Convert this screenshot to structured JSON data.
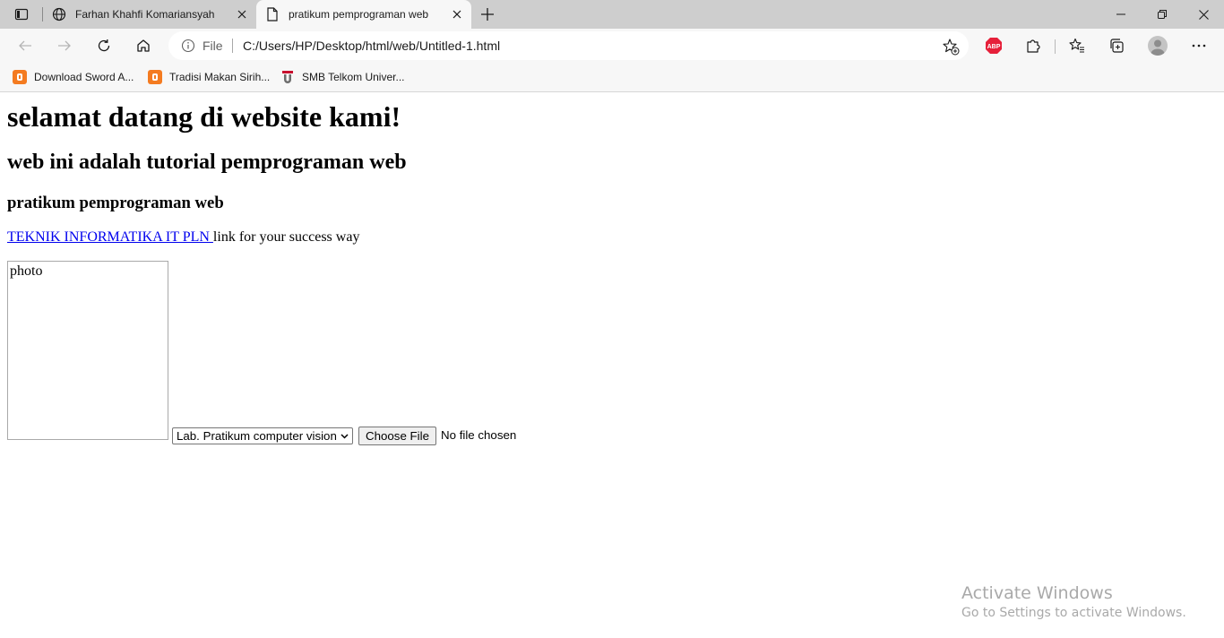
{
  "browser": {
    "tabs": [
      {
        "title": "Farhan Khahfi Komariansyah",
        "icon": "globe-icon",
        "active": false
      },
      {
        "title": "pratikum pemprograman web",
        "icon": "page-icon",
        "active": true
      }
    ],
    "address": {
      "scheme_label": "File",
      "url": "C:/Users/HP/Desktop/html/web/Untitled-1.html"
    },
    "extension_abp_label": "ABP",
    "bookmarks": [
      {
        "label": "Download Sword A...",
        "icon": "blogger-icon"
      },
      {
        "label": "Tradisi Makan Sirih...",
        "icon": "blogger-icon"
      },
      {
        "label": "SMB Telkom Univer...",
        "icon": "telkom-icon"
      }
    ]
  },
  "page": {
    "h1": "selamat datang di website kami!",
    "h2": "web ini adalah tutorial pemprograman web",
    "h3": "pratikum pemprograman web",
    "link_text": "TEKNIK INFORMATIKA IT PLN ",
    "link_suffix": "link for your success way",
    "image_alt": "photo",
    "select_value": "Lab. Pratikum computer vision",
    "file_button": "Choose File",
    "file_status": "No file chosen"
  },
  "watermark": {
    "title": "Activate Windows",
    "subtitle": "Go to Settings to activate Windows."
  },
  "colors": {
    "link": "#0000ee",
    "abp": "#e6203a",
    "blogger": "#f47b20"
  }
}
